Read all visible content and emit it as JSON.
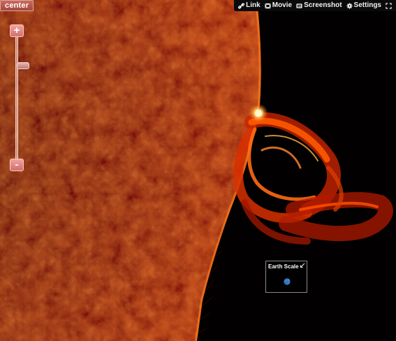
{
  "center_button": {
    "label": "center"
  },
  "toolbar": {
    "items": [
      {
        "label": "Link",
        "icon": "link-icon"
      },
      {
        "label": "Movie",
        "icon": "movie-icon"
      },
      {
        "label": "Screenshot",
        "icon": "camera-icon"
      },
      {
        "label": "Settings",
        "icon": "gear-icon"
      }
    ],
    "fullscreen_icon": "fullscreen-icon"
  },
  "zoom": {
    "in_label": "+",
    "out_label": "-",
    "level": 0.78
  },
  "earth_scale": {
    "title": "Earth Scale",
    "collapse_icon": "collapse-arrow-icon",
    "globe_icon": "earth-globe-icon"
  },
  "colors": {
    "accent": "#c86a5e",
    "sun_core": "#b01000",
    "sun_limb": "#ff6a00",
    "background": "#000000"
  }
}
